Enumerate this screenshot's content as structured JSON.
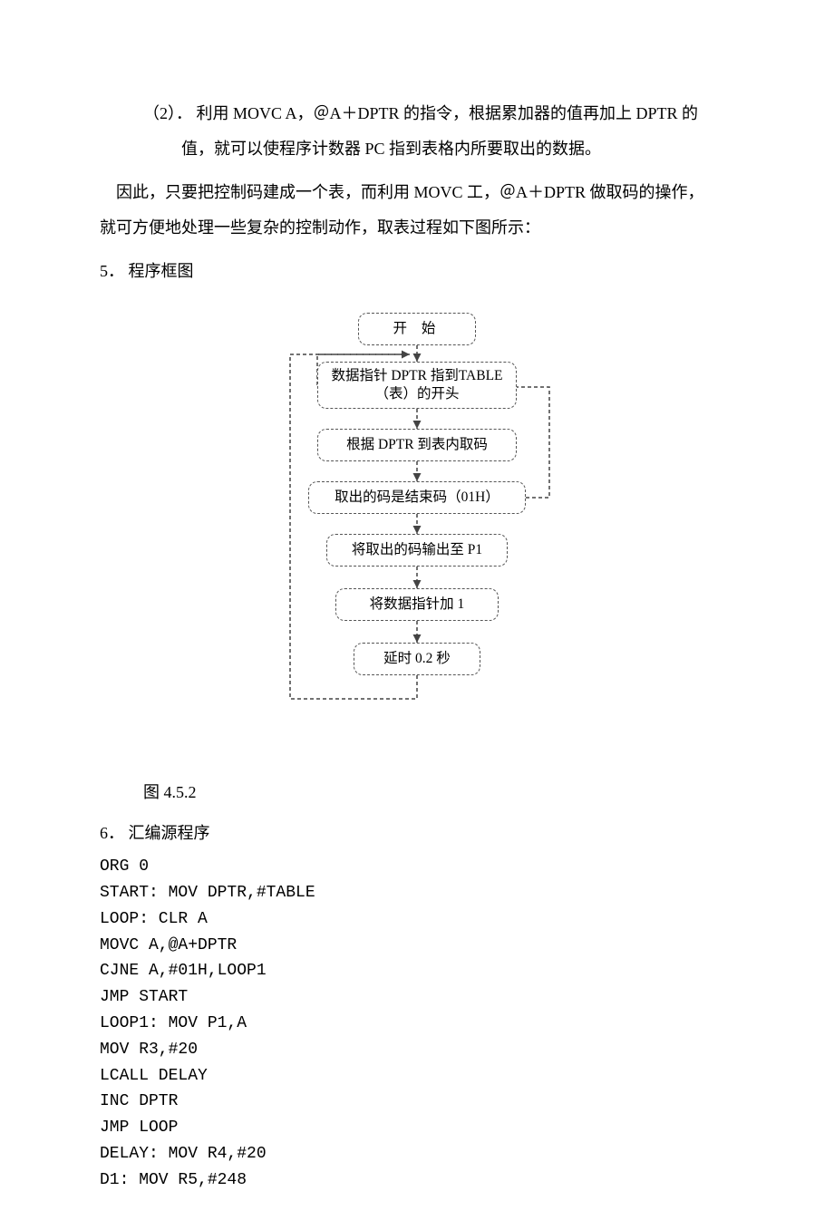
{
  "item2_line1": "（2）． 利用 MOVC  A，＠A＋DPTR 的指令，根据累加器的值再加上 DPTR 的",
  "item2_line2": "值，就可以使程序计数器 PC 指到表格内所要取出的数据。",
  "para_conclude_l1": "因此，只要把控制码建成一个表，而利用 MOVC  工，＠A＋DPTR 做取码的操作，",
  "para_conclude_l2": "就可方便地处理一些复杂的控制动作，取表过程如下图所示：",
  "heading_flow": "5． 程序框图",
  "flow": {
    "start": "开  始",
    "dptr": "数据指针 DPTR 指到TABLE（表）的开头",
    "get": "根据 DPTR 到表内取码",
    "end": "取出的码是结束码（01H）",
    "out": "将取出的码输出至 P1",
    "inc": "将数据指针加 1",
    "delay": "延时 0.2 秒"
  },
  "caption": "图 4.5.2",
  "heading_code": "6． 汇编源程序",
  "code_lines": [
    "ORG 0",
    "START: MOV DPTR,#TABLE",
    "LOOP: CLR A",
    "MOVC A,@A+DPTR",
    "CJNE A,#01H,LOOP1",
    "JMP START",
    "LOOP1: MOV P1,A",
    "MOV R3,#20",
    "LCALL DELAY",
    "INC DPTR",
    "JMP LOOP",
    "DELAY: MOV R4,#20",
    "D1: MOV R5,#248"
  ]
}
